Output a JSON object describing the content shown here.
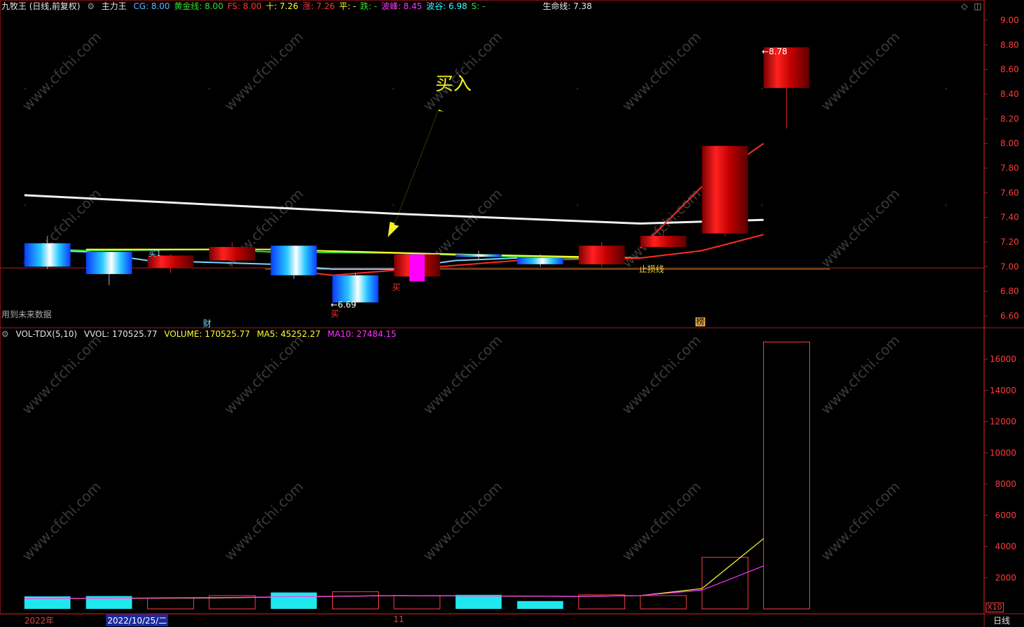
{
  "main_header": {
    "title": "九牧王 (日线,前复权)",
    "indicator": "主力王",
    "items": [
      {
        "text": "CG: 8.00",
        "color": "#5fb4ff"
      },
      {
        "text": "黄金线: 8.00",
        "color": "#33dd33"
      },
      {
        "text": "FS: 8.00",
        "color": "#ff3333"
      },
      {
        "text": "十: 7.26",
        "color": "#ffff33"
      },
      {
        "text": "涨: 7.26",
        "color": "#ff3333"
      },
      {
        "text": "平: -",
        "color": "#ffff33"
      },
      {
        "text": "跌: -",
        "color": "#33dd33"
      },
      {
        "text": "波峰: 8.45",
        "color": "#ff33ff"
      },
      {
        "text": "波谷: 6.98",
        "color": "#33ffff"
      },
      {
        "text": "S: -",
        "color": "#33dd33"
      }
    ],
    "lifeline": "生命线: 7.38"
  },
  "vol_header": {
    "name": "VOL-TDX(5,10)",
    "vvol": "VVOL: 170525.77",
    "volume": "VOLUME: 170525.77",
    "ma5": "MA5: 45252.27",
    "ma10": "MA10: 27484.15"
  },
  "annotations": {
    "buy_big": "买入",
    "buy_small": "买",
    "buy_small2": "买",
    "low_label": "6.69",
    "high_label": "8.78",
    "stoploss": "止损线",
    "future_data": "用到未来数据",
    "cai": "财",
    "bang": "榜",
    "muoling": "买1"
  },
  "x_labels": {
    "year": "2022年",
    "date": "2022/10/25/二",
    "month": "11"
  },
  "footer": {
    "period": "日线",
    "multiplier": "X10"
  },
  "watermark": "www.cfchi.com",
  "chart_data": [
    {
      "type": "candlestick",
      "ylim": [
        6.6,
        9.0
      ],
      "y_ticks": [
        "9.00",
        "8.80",
        "8.60",
        "8.40",
        "8.20",
        "8.00",
        "7.80",
        "7.60",
        "7.40",
        "7.20",
        "7.00",
        "6.80",
        "6.60"
      ],
      "candles": [
        {
          "open": 7.19,
          "close": 7.0,
          "high": 7.25,
          "low": 6.98,
          "style": "blue"
        },
        {
          "open": 7.12,
          "close": 6.94,
          "high": 7.12,
          "low": 6.85,
          "style": "blue"
        },
        {
          "open": 6.99,
          "close": 7.09,
          "high": 7.1,
          "low": 6.95,
          "style": "red"
        },
        {
          "open": 7.05,
          "close": 7.16,
          "high": 7.2,
          "low": 7.02,
          "style": "red"
        },
        {
          "open": 7.17,
          "close": 6.93,
          "high": 7.17,
          "low": 6.9,
          "style": "blue"
        },
        {
          "open": 6.93,
          "close": 6.71,
          "high": 6.95,
          "low": 6.69,
          "style": "blue"
        },
        {
          "open": 6.92,
          "close": 7.1,
          "high": 7.1,
          "low": 6.9,
          "style": "red"
        },
        {
          "open": 7.1,
          "close": 7.08,
          "high": 7.13,
          "low": 7.06,
          "style": "blue"
        },
        {
          "open": 7.07,
          "close": 7.02,
          "high": 7.1,
          "low": 7.0,
          "style": "blue"
        },
        {
          "open": 7.02,
          "close": 7.17,
          "high": 7.2,
          "low": 7.0,
          "style": "red"
        },
        {
          "open": 7.16,
          "close": 7.25,
          "high": 7.3,
          "low": 7.16,
          "style": "red"
        },
        {
          "open": 7.27,
          "close": 7.98,
          "high": 7.98,
          "low": 7.25,
          "style": "red"
        },
        {
          "open": 8.45,
          "close": 8.78,
          "high": 8.78,
          "low": 8.12,
          "style": "red"
        }
      ],
      "buy_candle": {
        "index": 6,
        "top": 7.1,
        "bottom": 6.88
      },
      "series": [
        {
          "name": "生命线",
          "color": "#f0f0f0",
          "points": [
            [
              0,
              7.58
            ],
            [
              6,
              7.43
            ],
            [
              10,
              7.35
            ],
            [
              12,
              7.38
            ]
          ]
        },
        {
          "name": "黄金线",
          "color": "#33dd33",
          "points": [
            [
              0,
              7.15
            ],
            [
              1,
              7.13
            ],
            [
              3,
              7.14
            ],
            [
              4,
              7.12
            ],
            [
              6,
              7.11
            ],
            [
              8,
              7.08
            ],
            [
              9,
              7.07
            ],
            [
              10,
              7.07
            ]
          ]
        },
        {
          "name": "十",
          "color": "#ffff33",
          "points": [
            [
              1,
              7.14
            ],
            [
              4,
              7.14
            ],
            [
              7,
              7.1
            ],
            [
              10,
              7.07
            ]
          ]
        },
        {
          "name": "波谷",
          "color": "#7ad7ff",
          "points": [
            [
              0,
              7.14
            ],
            [
              1,
              7.12
            ],
            [
              2,
              7.05
            ],
            [
              4,
              7.02
            ],
            [
              5,
              6.98
            ],
            [
              6,
              6.98
            ],
            [
              7,
              7.05
            ],
            [
              8,
              7.07
            ]
          ]
        },
        {
          "name": "FS",
          "color": "#ff2a2a",
          "points": [
            [
              4,
              6.99
            ],
            [
              5,
              6.93
            ],
            [
              6,
              6.97
            ],
            [
              8,
              7.05
            ],
            [
              10,
              7.07
            ],
            [
              11,
              7.13
            ],
            [
              12,
              7.26
            ]
          ]
        },
        {
          "name": "CG",
          "color": "#ff2a2a",
          "points": [
            [
              10,
              7.15
            ],
            [
              11,
              7.65
            ],
            [
              12,
              8.0
            ]
          ]
        }
      ],
      "hlines": [
        {
          "value": 6.99,
          "color": "#b02020"
        },
        {
          "value": 6.98,
          "color": "#b8a020"
        }
      ]
    },
    {
      "type": "bar",
      "ylim": [
        0,
        17500
      ],
      "y_ticks": [
        "16000",
        "14000",
        "12000",
        "10000",
        "8000",
        "6000",
        "4000",
        "2000"
      ],
      "values": [
        800,
        820,
        700,
        850,
        1050,
        1100,
        850,
        900,
        500,
        900,
        850,
        3300,
        17100
      ],
      "styles": [
        "cyan",
        "cyan",
        "hollow",
        "hollow",
        "cyan",
        "hollow",
        "hollow",
        "cyan",
        "cyan",
        "hollow",
        "hollow",
        "hollow",
        "hollow"
      ],
      "series": [
        {
          "name": "MA5",
          "color": "#ffff33",
          "points": [
            [
              0,
              650
            ],
            [
              3,
              700
            ],
            [
              6,
              850
            ],
            [
              9,
              800
            ],
            [
              10,
              850
            ],
            [
              11,
              1300
            ],
            [
              12,
              4500
            ]
          ]
        },
        {
          "name": "MA10",
          "color": "#ff33ff",
          "points": [
            [
              0,
              650
            ],
            [
              3,
              720
            ],
            [
              6,
              850
            ],
            [
              9,
              800
            ],
            [
              10,
              850
            ],
            [
              11,
              1200
            ],
            [
              12,
              2750
            ]
          ]
        }
      ]
    }
  ]
}
